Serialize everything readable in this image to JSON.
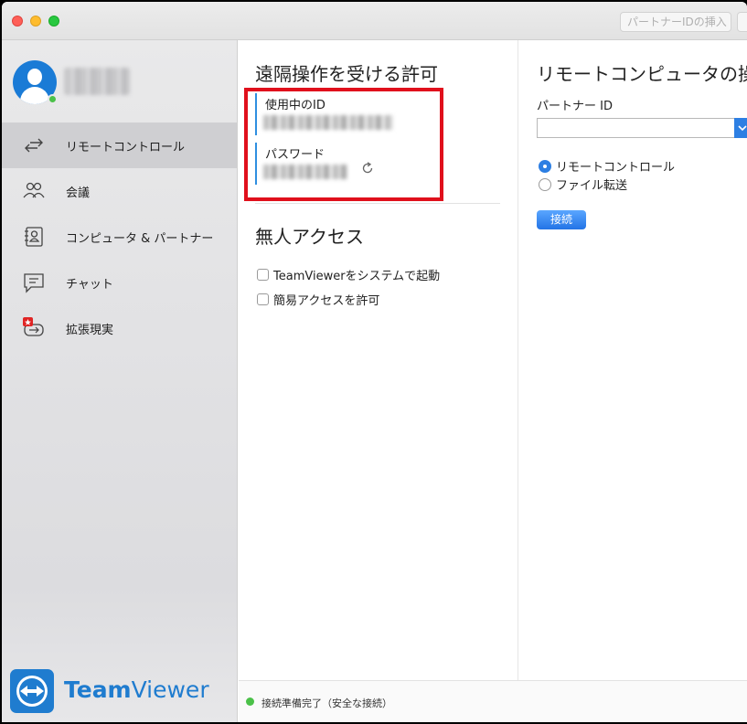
{
  "titlebar": {
    "insert_partner_id_label": "パートナーIDの挿入"
  },
  "sidebar": {
    "user_name": "",
    "items": [
      {
        "label": "リモートコントロール",
        "icon": "arrows-swap-icon",
        "active": true
      },
      {
        "label": "会議",
        "icon": "people-icon",
        "active": false
      },
      {
        "label": "コンピュータ & パートナー",
        "icon": "contact-book-icon",
        "active": false
      },
      {
        "label": "チャット",
        "icon": "chat-icon",
        "active": false
      },
      {
        "label": "拡張現実",
        "icon": "ar-glasses-icon",
        "active": false
      }
    ],
    "brand": {
      "bold": "Team",
      "regular": "Viewer"
    }
  },
  "allow_remote": {
    "title": "遠隔操作を受ける許可",
    "id_label": "使用中のID",
    "id_value": "",
    "password_label": "パスワード",
    "password_value": ""
  },
  "unattended": {
    "title": "無人アクセス",
    "options": [
      {
        "label": "TeamViewerをシステムで起動",
        "checked": false
      },
      {
        "label": "簡易アクセスを許可",
        "checked": false
      }
    ]
  },
  "remote_control": {
    "title": "リモートコンピュータの操",
    "partner_id_label": "パートナー ID",
    "partner_id_value": "",
    "modes": [
      {
        "label": "リモートコントロール",
        "selected": true
      },
      {
        "label": "ファイル転送",
        "selected": false
      }
    ],
    "connect_label": "接続"
  },
  "status": {
    "text": "接続準備完了（安全な接続）",
    "color": "#4bc149"
  },
  "colors": {
    "accent": "#2d7fe3",
    "brand": "#1f7ccf",
    "highlight_box": "#e0101c"
  }
}
